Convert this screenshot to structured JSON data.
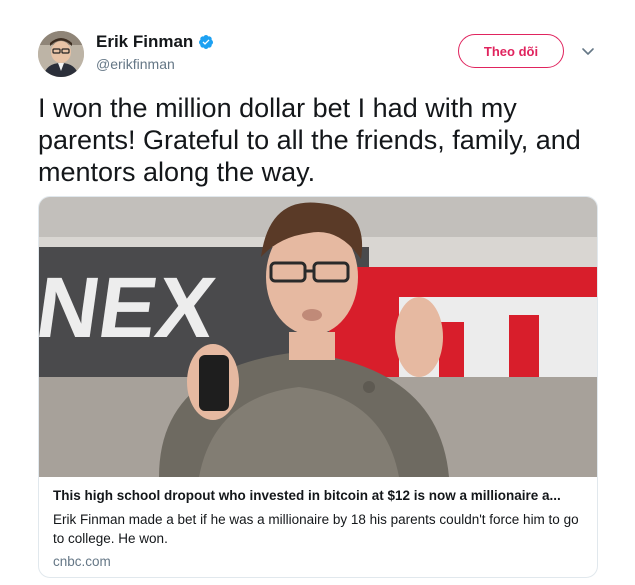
{
  "user": {
    "display_name": "Erik Finman",
    "handle": "@erikfinman",
    "verified": true,
    "avatar_icon": "profile-photo"
  },
  "actions": {
    "follow_label": "Theo dõi",
    "more_icon": "chevron-down-icon"
  },
  "tweet": {
    "text": "I won the million dollar bet I had with my parents! Grateful to all the friends, family, and mentors along the way."
  },
  "card": {
    "image_text": "NEX",
    "title": "This high school dropout who invested in bitcoin at $12 is now a millionaire a...",
    "description": "Erik Finman made a bet if he was a millionaire by 18 his parents couldn't force him to go to college. He won.",
    "domain": "cnbc.com"
  },
  "colors": {
    "follow_accent": "#e0245e",
    "verified_blue": "#1da1f2",
    "secondary_text": "#657786"
  }
}
